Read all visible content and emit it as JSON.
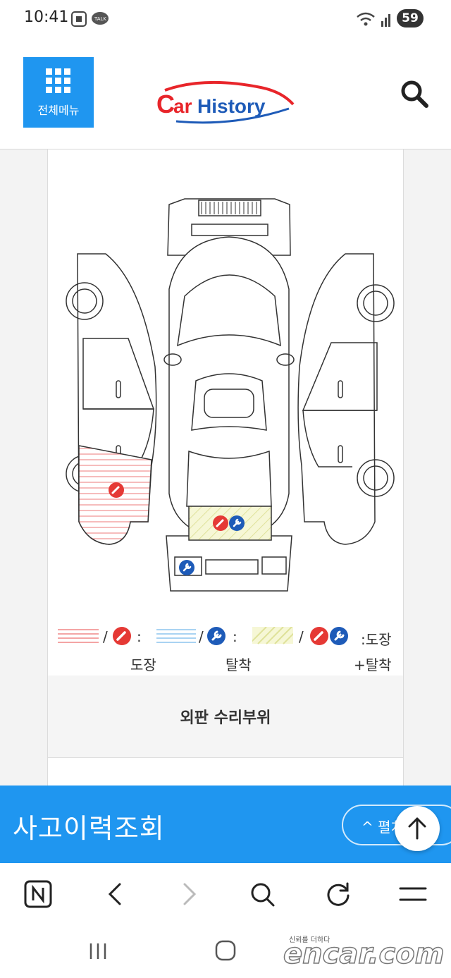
{
  "status_bar": {
    "time": "10:41",
    "battery": "59"
  },
  "header": {
    "menu_label": "전체메뉴",
    "logo_text": "CarHistory"
  },
  "diagram": {
    "legend": {
      "paint": "도장",
      "removal": "탈착",
      "both_prefix": ":도장",
      "both_suffix": "+탈착"
    }
  },
  "section": {
    "title": "외판 수리부위"
  },
  "accident_bar": {
    "title": "사고이력조회",
    "expand_label": "^ 펼치기"
  },
  "watermark": {
    "tagline": "신뢰를 더하다",
    "brand": "encar.com"
  },
  "colors": {
    "accent": "#1f96f0",
    "paint_red": "#e53935",
    "removal_blue": "#1e5bb8",
    "paint_hatch": "#f4a5a5",
    "both_hatch": "#e5e8a0"
  }
}
